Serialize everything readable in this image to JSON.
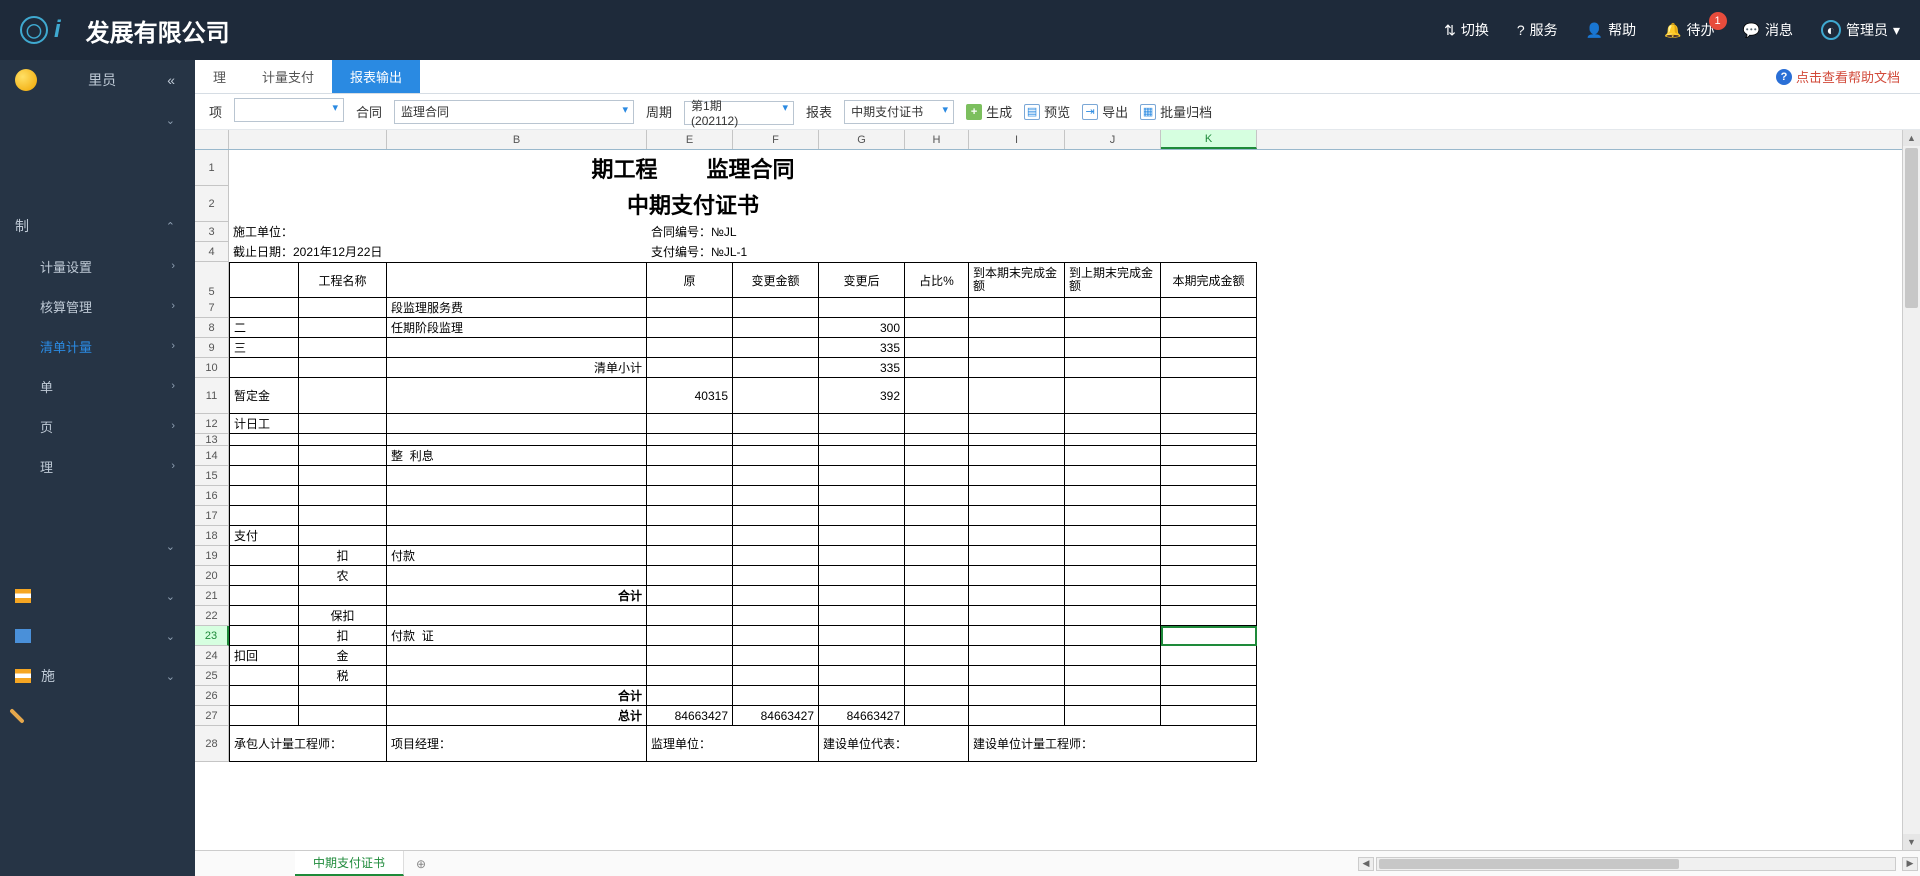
{
  "header": {
    "company": "发展有限公司",
    "logo_letter": "i",
    "nav": {
      "switch": "切换",
      "service": "服务",
      "help": "帮助",
      "todo": "待办",
      "todo_badge": "1",
      "message": "消息",
      "admin": "管理员"
    }
  },
  "sidebar": {
    "user_label": "里员",
    "groups": {
      "g1": "",
      "g2": "制",
      "g2_children": {
        "a": "计量设置",
        "b": "核算管理",
        "c": "清单计量",
        "d": "单",
        "e": "页",
        "f": "理"
      },
      "g3": "",
      "g4": "",
      "g5": "",
      "g6": "施"
    }
  },
  "tabs": {
    "t1": "理",
    "t2": "计量支付",
    "t3": "报表输出",
    "help_link": "点击查看帮助文档"
  },
  "toolbar": {
    "proj_label": "项",
    "sel1": "",
    "contract_label": "合同",
    "sel2": "监理合同",
    "period_label": "周期",
    "period_value": "第1期 (202112)",
    "report_label": "报表",
    "report_value": "中期支付证书",
    "generate": "生成",
    "preview": "预览",
    "export": "导出",
    "batch": "批量归档"
  },
  "sheet": {
    "cols": [
      "",
      "B",
      "",
      "",
      "E",
      "F",
      "G",
      "H",
      "I",
      "J",
      "K"
    ],
    "title_line1_a": "期工程",
    "title_line1_b": "监理合同",
    "title_line2": "中期支付证书",
    "施工单位": "施工单位：",
    "截止日期": "截止日期：2021年12月22日",
    "合同编号": "合同编号：№JL",
    "支付编号": "支付编号：№JL-1",
    "hdr_name": "工程名称",
    "hdr_原": "原",
    "hdr_变更金额": "变更金额",
    "hdr_变更后": "变更后",
    "hdr_占比": "占比%",
    "hdr_到本期": "到本期末完成金额",
    "hdr_到上期": "到上期末完成金额",
    "hdr_本期": "本期完成金额",
    "r7": "段监理服务费",
    "r8_a": "二",
    "r8_b": "任期阶段监理",
    "r9": "三",
    "r10": "清单小计",
    "r11": "暂定金",
    "r12": "计日工",
    "r14_a": "整",
    "r14_b": "利息",
    "r18": "支付",
    "r19": "付款",
    "r19_b": "扣",
    "r20": "农",
    "r21": "合计",
    "r22_a": "保",
    "r22_b": "扣",
    "r23": "付款",
    "r23_b": "证",
    "r24_a": "扣回",
    "r24_b": "金",
    "r25": "税",
    "r26": "合计",
    "r27": "总计",
    "v_原": "40315",
    "v_300": "300",
    "v_335a": "335",
    "v_335b": "335",
    "v_392": "392",
    "v27_a": "84663427",
    "v27_b": "84663427",
    "v27_c": "84663427",
    "sig1": "承包人计量工程师：",
    "sig2": "项目经理：",
    "sig3": "监理单位：",
    "sig4": "建设单位代表：",
    "sig5": "建设单位计量工程师：",
    "tab_name": "中期支付证书"
  }
}
